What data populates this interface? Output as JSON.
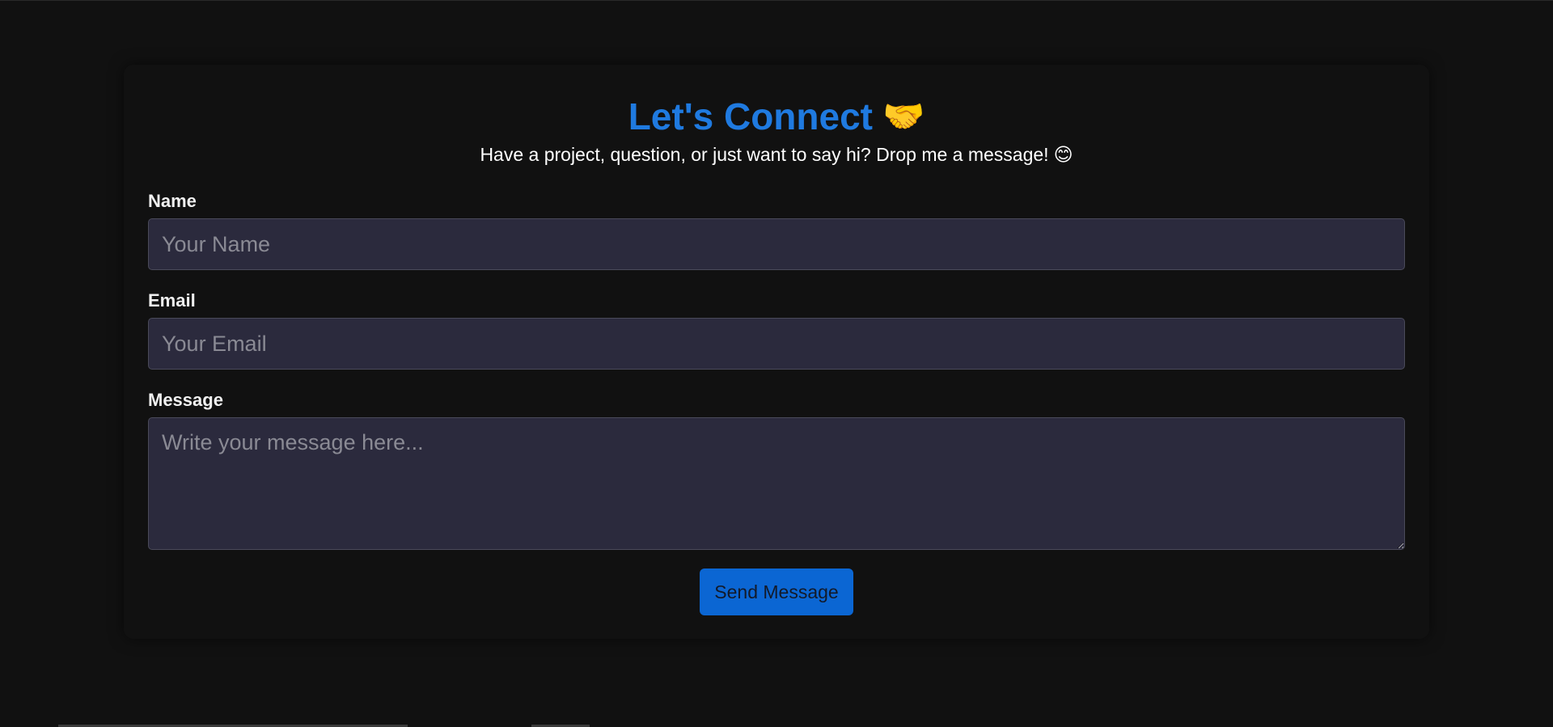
{
  "header": {
    "title": "Let's Connect",
    "title_emoji": "🤝",
    "subtitle": "Have a project, question, or just want to say hi? Drop me a message!",
    "subtitle_emoji": "😊"
  },
  "form": {
    "name": {
      "label": "Name",
      "placeholder": "Your Name",
      "value": ""
    },
    "email": {
      "label": "Email",
      "placeholder": "Your Email",
      "value": ""
    },
    "message": {
      "label": "Message",
      "placeholder": "Write your message here...",
      "value": ""
    },
    "submit_label": "Send Message"
  },
  "colors": {
    "background": "#111111",
    "accent": "#1f7ae0",
    "button": "#0b66d3",
    "field_background": "#2b2a3d"
  }
}
